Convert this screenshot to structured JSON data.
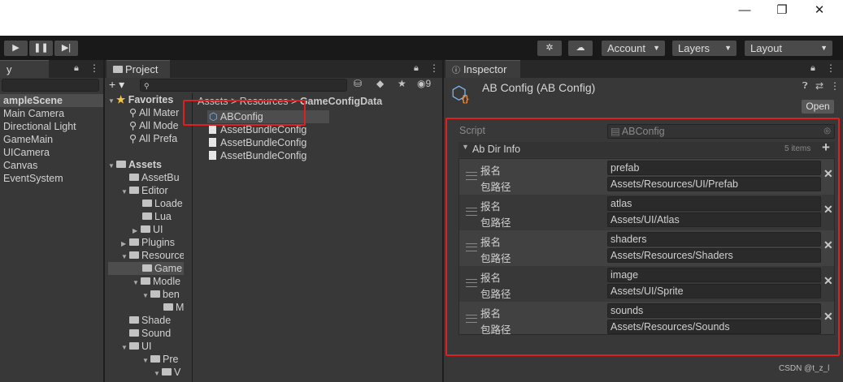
{
  "window": {
    "minimize": "—",
    "maximize": "❐",
    "close": "✕"
  },
  "toolbar": {
    "play": "▶",
    "pause": "❚❚",
    "step": "▶|",
    "account": "Account",
    "layers": "Layers",
    "layout": "Layout"
  },
  "hierarchy": {
    "tab": "y",
    "scene": "ampleScene",
    "items": [
      "Main Camera",
      "Directional Light",
      "GameMain",
      "UICamera",
      "Canvas",
      "EventSystem"
    ]
  },
  "project": {
    "tab": "Project",
    "add_label": "+ ▾",
    "hidden_count": "9",
    "favorites": {
      "label": "Favorites",
      "items": [
        "All Mater",
        "All Mode",
        "All Prefa"
      ]
    },
    "assets_label": "Assets",
    "tree": [
      "AssetBu",
      "Editor",
      "Loade",
      "Lua",
      "UI",
      "Plugins",
      "Resource",
      "Game",
      "Modle",
      "ben",
      "M",
      "Shade",
      "Sound",
      "UI",
      "Pre",
      "V"
    ],
    "breadcrumb": {
      "part1": "Assets",
      "part2": "Resources",
      "part3": "GameConfigData",
      "sep": ">"
    },
    "files": [
      "ABConfig",
      "AssetBundleConfig",
      "AssetBundleConfig",
      "AssetBundleConfig"
    ]
  },
  "inspector": {
    "tab": "Inspector",
    "title": "AB Config (AB Config)",
    "open_button": "Open",
    "script_label": "Script",
    "script_value": "ABConfig",
    "list_label": "Ab Dir Info",
    "list_count": "5 items",
    "name_label": "报名",
    "path_label": "包路径",
    "entries": [
      {
        "name": "prefab",
        "path": "Assets/Resources/UI/Prefab"
      },
      {
        "name": "atlas",
        "path": "Assets/UI/Atlas"
      },
      {
        "name": "shaders",
        "path": "Assets/Resources/Shaders"
      },
      {
        "name": "image",
        "path": "Assets/UI/Sprite"
      },
      {
        "name": "sounds",
        "path": "Assets/Resources/Sounds"
      }
    ]
  },
  "watermark": "CSDN @t_z_l"
}
